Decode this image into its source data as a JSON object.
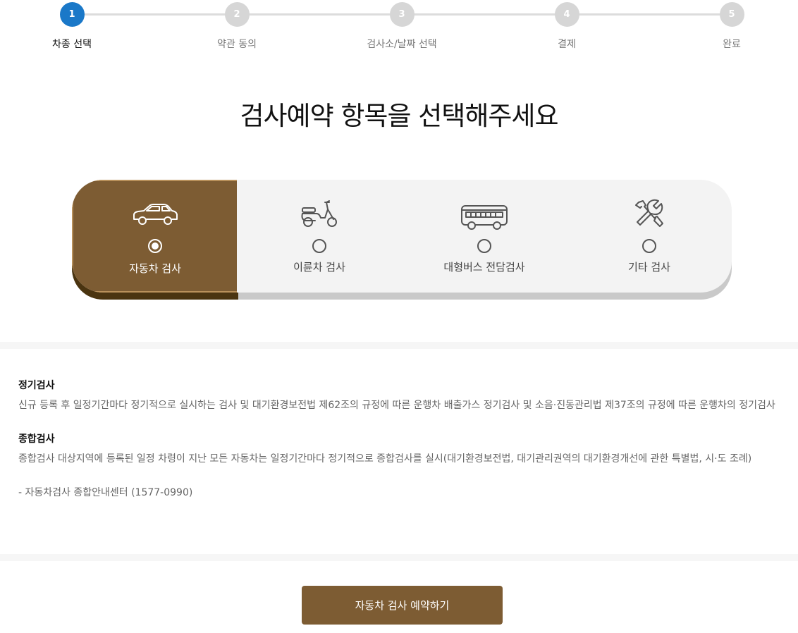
{
  "steps": [
    {
      "number": "1",
      "label": "차종 선택",
      "active": true
    },
    {
      "number": "2",
      "label": "약관 동의",
      "active": false
    },
    {
      "number": "3",
      "label": "검사소/날짜 선택",
      "active": false
    },
    {
      "number": "4",
      "label": "결제",
      "active": false
    },
    {
      "number": "5",
      "label": "완료",
      "active": false
    }
  ],
  "title": "검사예약 항목을 선택해주세요",
  "vehicle_options": [
    {
      "label": "자동차 검사",
      "icon": "car-icon",
      "selected": true
    },
    {
      "label": "이륜차 검사",
      "icon": "scooter-icon",
      "selected": false
    },
    {
      "label": "대형버스 전담검사",
      "icon": "bus-icon",
      "selected": false
    },
    {
      "label": "기타 검사",
      "icon": "tools-icon",
      "selected": false
    }
  ],
  "description": {
    "regular_heading": "정기검사",
    "regular_text": "신규 등록 후 일정기간마다 정기적으로 실시하는 검사 및 대기환경보전법 제62조의 규정에 따른 운행차 배출가스 정기검사 및 소음·진동관리법 제37조의 규정에 따른 운행차의 정기검사",
    "comprehensive_heading": "종합검사",
    "comprehensive_text": "종합검사 대상지역에 등록된 일정 차령이 지난 모든 자동차는 일정기간마다 정기적으로 종합검사를 실시(대기환경보전법, 대기관리권역의 대기환경개선에 관한 특별법, 시·도 조례)",
    "contact": "- 자동차검사 종합안내센터 (1577-0990)"
  },
  "reserve_button": "자동차 검사 예약하기",
  "colors": {
    "accent_brown": "#7d5c33",
    "active_step_blue": "#1a78c8",
    "inactive_step_gray": "#d6d6d6"
  }
}
